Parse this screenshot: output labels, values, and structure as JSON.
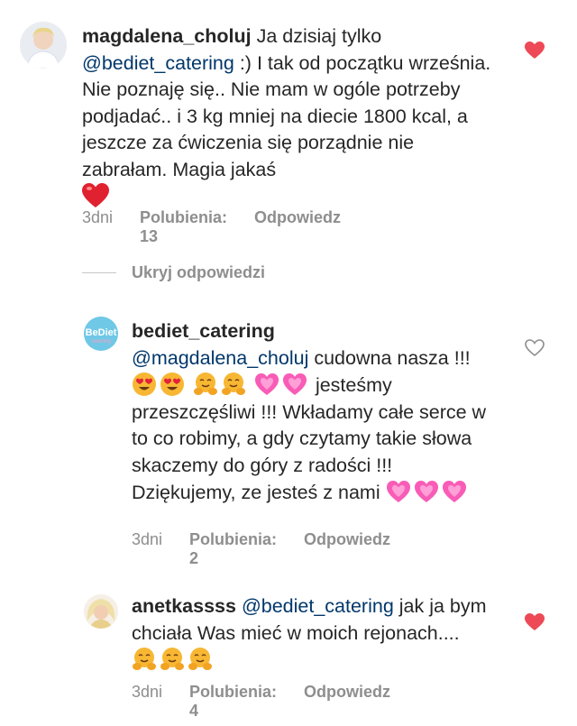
{
  "comments": [
    {
      "username": "magdalena_choluj",
      "text_before": " Ja dzisiaj tylko ",
      "mention": "@bediet_catering",
      "text_after": " :) I tak od początku września. Nie poznaję się.. Nie mam w ogóle potrzeby podjadać.. i 3 kg mniej na diecie 1800 kcal, a jeszcze za ćwiczenia się porządnie nie zabrałam. Magia jakaś",
      "time": "3dni",
      "likes": "Polubienia: 13",
      "reply": "Odpowiedz",
      "liked": true
    },
    {
      "username": "bediet_catering",
      "mention": "@magdalena_choluj",
      "text_after": " cudowna nasza !!!",
      "text_mid": " jesteśmy przeszczęśliwi !!! Wkładamy całe serce w to co robimy, a gdy czytamy takie słowa skaczemy do góry z radości !!! Dziękujemy, ze jesteś z nami",
      "time": "3dni",
      "likes": "Polubienia: 2",
      "reply": "Odpowiedz",
      "liked": false,
      "avatar_text": "BeDiet",
      "avatar_sub": "catering"
    },
    {
      "username": "anetkassss",
      "mention": "@bediet_catering",
      "text_after": " jak ja bym chciała Was mieć w moich rejonach....",
      "time": "3dni",
      "likes": "Polubienia: 4",
      "reply": "Odpowiedz",
      "liked": true
    }
  ],
  "replies_toggle": "Ukryj odpowiedzi",
  "colors": {
    "heart_red": "#ed4956",
    "mention": "#00376b",
    "meta": "#8e8e8e",
    "heart_pink": "#ff69c8",
    "hug": "#f7b733"
  }
}
